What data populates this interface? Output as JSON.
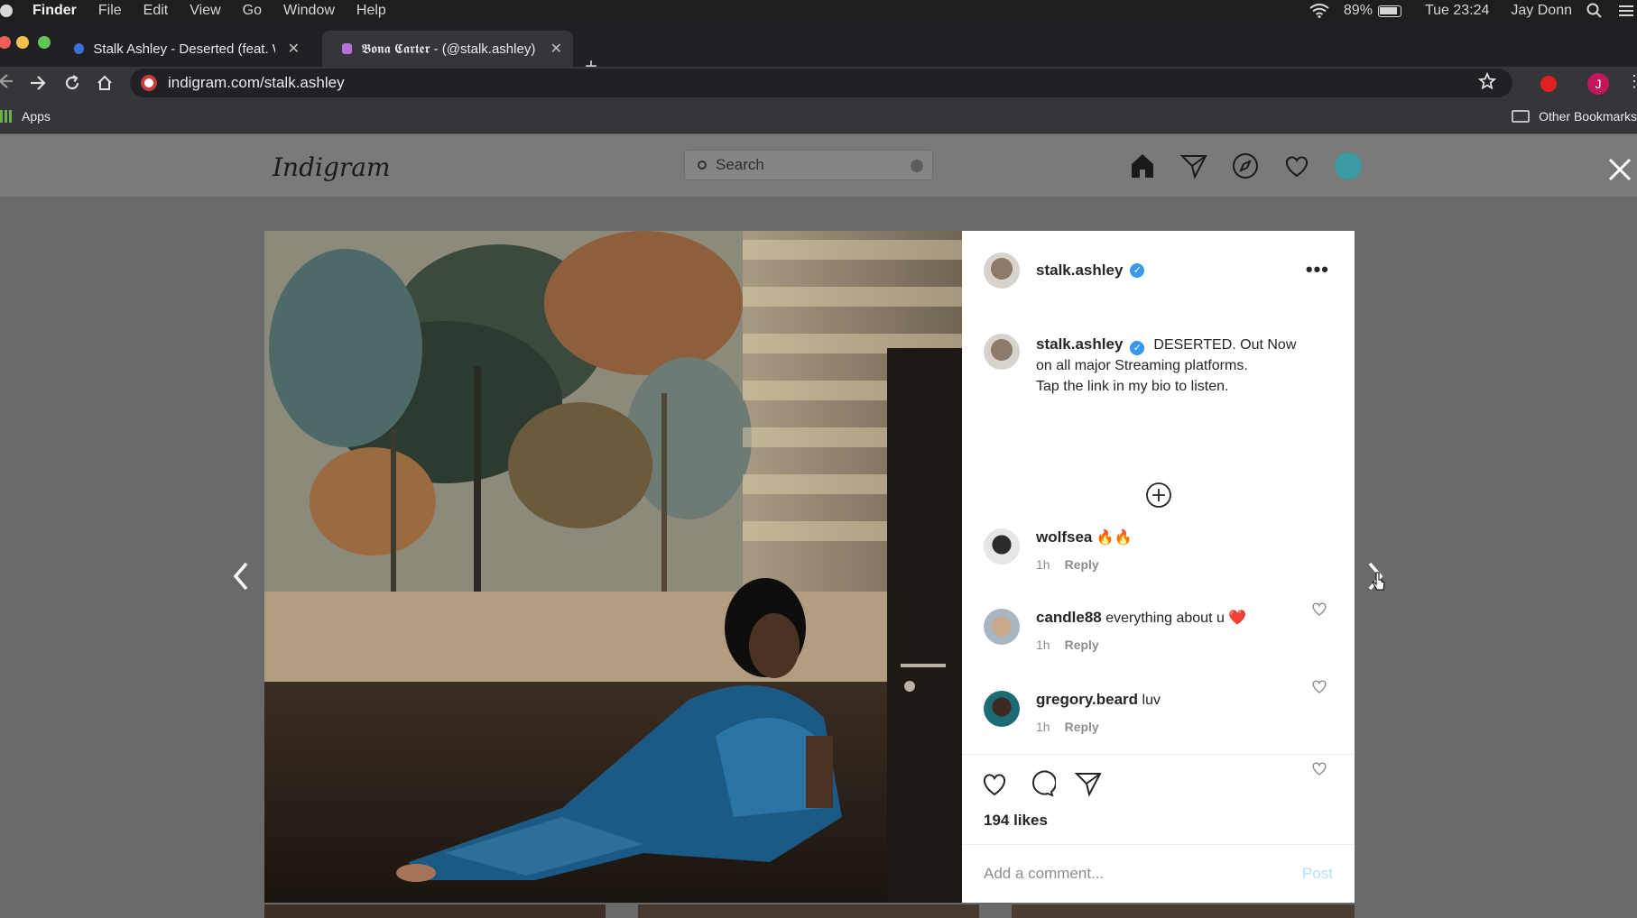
{
  "menubar": {
    "app": "Finder",
    "items": [
      "File",
      "Edit",
      "View",
      "Go",
      "Window",
      "Help"
    ],
    "battery": "89%",
    "clock": "Tue 23:24",
    "user": "Jay Donn"
  },
  "browser": {
    "tabs": [
      {
        "title": "Stalk Ashley - Deserted (feat. W",
        "close": "✕"
      },
      {
        "title": "𝕭𝖔𝖓𝖆 𝕮𝖆𝖗𝖙𝖊𝖗 - (@stalk.ashley)",
        "close": "✕"
      }
    ],
    "new_tab": "+",
    "url": "indigram.com/stalk.ashley",
    "profile_initial": "J",
    "bookmarks": {
      "apps": "Apps",
      "other": "Other Bookmarks"
    }
  },
  "instagram": {
    "logo": "Indigram",
    "search_placeholder": "Search",
    "post": {
      "username": "stalk.ashley",
      "caption_user": "stalk.ashley",
      "caption_lines": [
        "DESERTED. Out Now",
        "on all major Streaming platforms.",
        "Tap the link in my bio to listen."
      ],
      "comments": [
        {
          "user": "wolfsea",
          "text": "🔥🔥",
          "time": "1h",
          "reply": "Reply"
        },
        {
          "user": "candle88",
          "text": "everything about u ❤️",
          "time": "1h",
          "reply": "Reply"
        },
        {
          "user": "gregory.beard",
          "text": "luv",
          "time": "1h",
          "reply": "Reply"
        }
      ],
      "likes": "194 likes",
      "add_comment_placeholder": "Add a comment...",
      "post_button": "Post"
    }
  },
  "colors": {
    "overlay": "#6a6a6a",
    "verified": "#3897f0",
    "post_disabled": "#b2dffc",
    "avatar_nav": "#3c9aa2"
  }
}
